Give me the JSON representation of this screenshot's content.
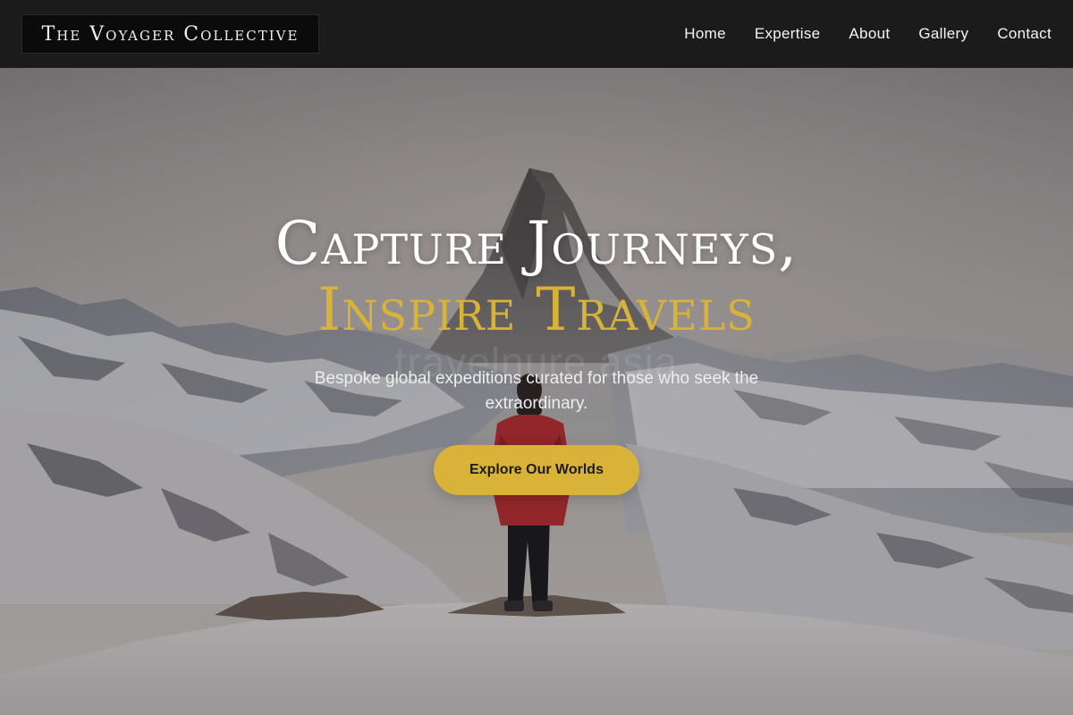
{
  "header": {
    "brand": "The Voyager Collective",
    "nav": [
      "Home",
      "Expertise",
      "About",
      "Gallery",
      "Contact"
    ]
  },
  "hero": {
    "title_line1": "Capture Journeys,",
    "title_line2": "Inspire Travels",
    "subtitle": "Bespoke global expeditions curated for those who seek the extraordinary.",
    "cta_label": "Explore Our Worlds",
    "watermark": "travelnure asia"
  },
  "colors": {
    "accent": "#d9b338",
    "header_bg": "#1b1b1b"
  }
}
